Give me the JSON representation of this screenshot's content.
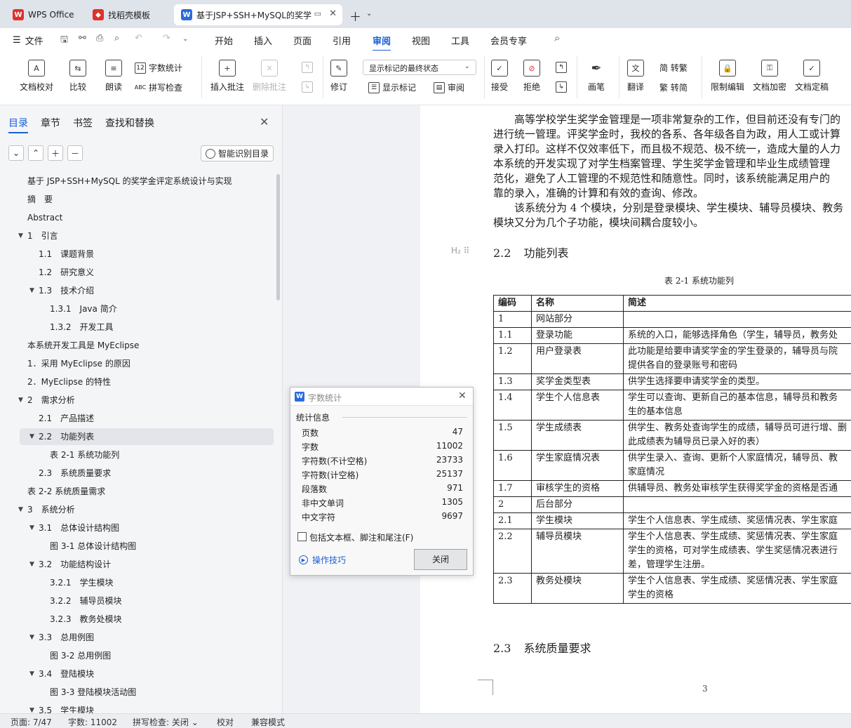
{
  "tabs": [
    {
      "label": "WPS Office"
    },
    {
      "label": "找稻壳模板"
    },
    {
      "label": "基于JSP+SSH+MySQL的奖学"
    }
  ],
  "menu": {
    "file": "文件",
    "items": [
      "开始",
      "插入",
      "页面",
      "引用",
      "审阅",
      "视图",
      "工具",
      "会员专享"
    ]
  },
  "ribbon": {
    "doc_check": "文档校对",
    "compare": "比较",
    "read_aloud": "朗读",
    "word_count": "字数统计",
    "spell_check": "拼写检查",
    "insert_comment": "插入批注",
    "delete_comment": "删除批注",
    "revise": "修订",
    "display_state": "显示标记的最终状态",
    "show_markup": "显示标记",
    "review_pane": "审阅",
    "accept": "接受",
    "reject": "拒绝",
    "pen": "画笔",
    "translate": "翻译",
    "to_trad": "简 转繁",
    "to_simp": "繁 转简",
    "restrict_edit": "限制编辑",
    "doc_encrypt": "文档加密",
    "doc_finalize": "文档定稿"
  },
  "sidebar": {
    "tabs": [
      "目录",
      "章节",
      "书签",
      "查找和替换"
    ],
    "smart_toc": "智能识别目录",
    "toc": [
      {
        "text": "基于 JSP+SSH+MySQL 的奖学金评定系统设计与实现",
        "level": 0,
        "arrow": ""
      },
      {
        "text": "摘　要",
        "level": 0,
        "arrow": ""
      },
      {
        "text": "Abstract",
        "level": 0,
        "arrow": ""
      },
      {
        "text": "1　引言",
        "level": 0,
        "arrow": "▼"
      },
      {
        "text": "1.1　课题背景",
        "level": 1,
        "arrow": ""
      },
      {
        "text": "1.2　研究意义",
        "level": 1,
        "arrow": ""
      },
      {
        "text": "1.3　技术介绍",
        "level": 1,
        "arrow": "▼"
      },
      {
        "text": "1.3.1　Java 简介",
        "level": 2,
        "arrow": ""
      },
      {
        "text": "1.3.2　开发工具",
        "level": 2,
        "arrow": ""
      },
      {
        "text": "本系统开发工具是 MyEclipse",
        "level": 0,
        "arrow": ""
      },
      {
        "text": "1．采用 MyEclipse 的原因",
        "level": 0,
        "arrow": ""
      },
      {
        "text": "2．MyEclipse 的特性",
        "level": 0,
        "arrow": ""
      },
      {
        "text": "2　需求分析",
        "level": 0,
        "arrow": "▼"
      },
      {
        "text": "2.1　产品描述",
        "level": 1,
        "arrow": ""
      },
      {
        "text": "2.2　功能列表",
        "level": 1,
        "arrow": "▼",
        "selected": true
      },
      {
        "text": "表 2-1  系统功能列",
        "level": 2,
        "arrow": ""
      },
      {
        "text": "2.3　系统质量要求",
        "level": 1,
        "arrow": ""
      },
      {
        "text": "表 2-2  系统质量需求",
        "level": 0,
        "arrow": ""
      },
      {
        "text": "3　系统分析",
        "level": 0,
        "arrow": "▼"
      },
      {
        "text": "3.1　总体设计结构图",
        "level": 1,
        "arrow": "▼"
      },
      {
        "text": "图 3-1  总体设计结构图",
        "level": 2,
        "arrow": ""
      },
      {
        "text": "3.2　功能结构设计",
        "level": 1,
        "arrow": "▼"
      },
      {
        "text": "3.2.1　学生模块",
        "level": 2,
        "arrow": ""
      },
      {
        "text": "3.2.2　辅导员模块",
        "level": 2,
        "arrow": ""
      },
      {
        "text": "3.2.3　教务处模块",
        "level": 2,
        "arrow": ""
      },
      {
        "text": "3.3　总用例图",
        "level": 1,
        "arrow": "▼"
      },
      {
        "text": "图 3-2  总用例图",
        "level": 2,
        "arrow": ""
      },
      {
        "text": "3.4　登陆模块",
        "level": 1,
        "arrow": "▼"
      },
      {
        "text": "图 3-3  登陆模块活动图",
        "level": 2,
        "arrow": ""
      },
      {
        "text": "3.5　学生模块",
        "level": 1,
        "arrow": "▼"
      }
    ]
  },
  "document": {
    "paragraph1": [
      "　　高等学校学生奖学金管理是一项非常复杂的工作，但目前还没有专门的",
      "进行统一管理。评奖学金时，我校的各系、各年级各自为政，用人工或计算",
      "录入打印。这样不仅效率低下，而且极不规范、极不统一，造成大量的人力",
      "本系统的开发实现了对学生档案管理、学生奖学金管理和毕业生成绩管理",
      "范化，避免了人工管理的不规范性和随意性。同时，该系统能满足用户的",
      "靠的录入，准确的计算和有效的查询、修改。"
    ],
    "paragraph2": [
      "　　该系统分为 4 个模块，分别是登录模块、学生模块、辅导员模块、教务",
      "模块又分为几个子功能，模块间耦合度较小。"
    ],
    "h2_mark": "H₂ ⠿",
    "heading_22": {
      "num": "2.2",
      "text": "功能列表"
    },
    "caption": "表 2-1  系统功能列",
    "table": {
      "headers": [
        "编码",
        "名称",
        "简述"
      ],
      "rows": [
        {
          "code": "1",
          "name": "网站部分",
          "desc": [
            ""
          ]
        },
        {
          "code": "1.1",
          "name": "登录功能",
          "desc": [
            "系统的入口，能够选择角色（学生，辅导员，教务处"
          ]
        },
        {
          "code": "1.2",
          "name": "用户登录表",
          "desc": [
            "此功能是给要申请奖学金的学生登录的，辅导员与院",
            "提供各自的登录账号和密码"
          ]
        },
        {
          "code": "1.3",
          "name": "奖学金类型表",
          "desc": [
            "供学生选择要申请奖学金的类型。"
          ]
        },
        {
          "code": "1.4",
          "name": "学生个人信息表",
          "desc": [
            "学生可以查询、更新自己的基本信息，辅导员和教务",
            "生的基本信息"
          ]
        },
        {
          "code": "1.5",
          "name": "学生成绩表",
          "desc": [
            "供学生、教务处查询学生的成绩，辅导员可进行增、删",
            "此成绩表为辅导员已录入好的表）"
          ]
        },
        {
          "code": "1.6",
          "name": "学生家庭情况表",
          "desc": [
            "供学生录入、查询、更新个人家庭情况，辅导员、教",
            "家庭情况"
          ]
        },
        {
          "code": "1.7",
          "name": "审核学生的资格",
          "desc": [
            "供辅导员、教务处审核学生获得奖学金的资格是否通"
          ]
        },
        {
          "code": "2",
          "name": "后台部分",
          "desc": [
            ""
          ]
        },
        {
          "code": "2.1",
          "name": "学生模块",
          "desc": [
            "学生个人信息表、学生成绩、奖惩情况表、学生家庭"
          ]
        },
        {
          "code": "2.2",
          "name": "辅导员模块",
          "desc": [
            "学生个人信息表、学生成绩、奖惩情况表、学生家庭",
            "学生的资格，可对学生成绩表、学生奖惩情况表进行",
            "差，管理学生注册。"
          ]
        },
        {
          "code": "2.3",
          "name": "教务处模块",
          "desc": [
            "学生个人信息表、学生成绩、奖惩情况表、学生家庭",
            "学生的资格"
          ]
        }
      ]
    },
    "heading_23": {
      "num": "2.3",
      "text": "系统质量要求"
    },
    "page_number": "3"
  },
  "dialog": {
    "title": "字数统计",
    "section": "统计信息",
    "stats": [
      {
        "label": "页数",
        "value": "47"
      },
      {
        "label": "字数",
        "value": "11002"
      },
      {
        "label": "字符数(不计空格)",
        "value": "23733"
      },
      {
        "label": "字符数(计空格)",
        "value": "25137"
      },
      {
        "label": "段落数",
        "value": "971"
      },
      {
        "label": "非中文单词",
        "value": "1305"
      },
      {
        "label": "中文字符",
        "value": "9697"
      }
    ],
    "checkbox_label": "包括文本框、脚注和尾注(F)",
    "tips": "操作技巧",
    "close": "关闭"
  },
  "statusbar": {
    "page": "页面: 7/47",
    "words": "字数: 11002",
    "spell": "拼写检查: 关闭",
    "proof": "校对",
    "compat": "兼容模式"
  },
  "colors": {
    "accent": "#1a5fd6",
    "wps_red": "#e0312c",
    "word_blue": "#2b6cdb"
  }
}
